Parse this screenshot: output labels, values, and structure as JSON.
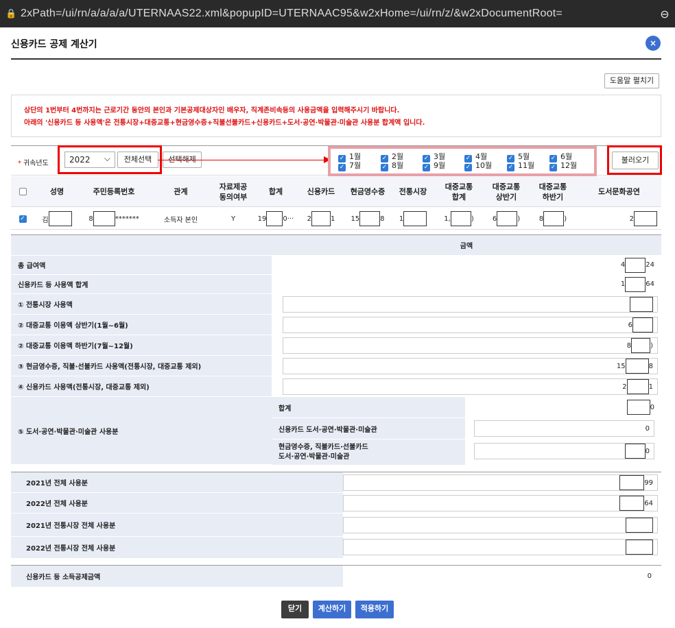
{
  "browser": {
    "url": "2xPath=/ui/rn/a/a/a/a/UTERNAAS22.xml&popupID=UTERNAAC95&w2xHome=/ui/rn/z/&w2xDocumentRoot=",
    "lock_icon": "lock-icon",
    "zoom_icon": "zoom-icon"
  },
  "popup": {
    "title": "신용카드 공제 계산기",
    "close_symbol": "×",
    "help_label": "도움말 펼치기"
  },
  "notice": {
    "line1": "상단의 1번부터 4번까지는 근로기간 동안의 본인과 기본공제대상자인 배우자, 직계존비속등의 사용금액을 입력해주시기 바랍니다.",
    "line2": "아래의 '신용카드 등 사용액'은 전통시장+대중교통+현금영수증+직불선불카드+신용카드+도서·공연·박물관·미술관 사용분 합계액 입니다.",
    "color": "#dd1111"
  },
  "controls": {
    "year_label": "귀속년도",
    "year_value": "2022",
    "select_all": "전체선택",
    "deselect_all": "선택해제",
    "load": "불러오기",
    "months": [
      "1월",
      "2월",
      "3월",
      "4월",
      "5월",
      "6월",
      "7월",
      "8월",
      "9월",
      "10월",
      "11월",
      "12월"
    ]
  },
  "grid": {
    "headers": [
      "성명",
      "주민등록번호",
      "관계",
      "자료제공\n동의여부",
      "합계",
      "신용카드",
      "현금영수증",
      "전통시장",
      "대중교통\n합계",
      "대중교통\n상반기",
      "대중교통\n하반기",
      "도서문화공연"
    ],
    "row": {
      "name": "김",
      "rrn_prefix": "8",
      "rrn_suffix": "*******",
      "relation": "소득자 본인",
      "consent": "Y",
      "total_a": "19",
      "total_b": "0···",
      "credit_a": "2",
      "credit_b": "1",
      "cash_a": "15",
      "cash_b": "8",
      "market": "1",
      "transit_total_a": "1,",
      "transit_total_b": ")",
      "transit_h1_a": "6",
      "transit_h1_b": ")",
      "transit_h2_a": "8",
      "transit_h2_b": ")",
      "culture": "2"
    }
  },
  "calc": {
    "amount_header": "금액",
    "rows": [
      {
        "label": "총 급여액",
        "pre": "4",
        "post": "24"
      },
      {
        "label": "신용카드 등 사용액 합계",
        "pre": "1",
        "post": "64"
      },
      {
        "label": "① 전통시장 사용액",
        "pre": "",
        "post": ""
      },
      {
        "label": "② 대중교통 이용액 상반기(1월~6월)",
        "pre": "6",
        "post": ""
      },
      {
        "label": "② 대중교통 이용액 하반기(7월~12월)",
        "pre": "8",
        "post": ")"
      },
      {
        "label": "③ 현금영수증, 직불·선불카드 사용액(전통시장, 대중교통 제외)",
        "pre": "15",
        "post": "8"
      },
      {
        "label": "④ 신용카드 사용액(전통시장, 대중교통 제외)",
        "pre": "2",
        "post": "1"
      }
    ],
    "culture": {
      "label": "⑤ 도서·공연·박물관·미술관 사용분",
      "sum_label": "합계",
      "sum_post": "0",
      "credit_label": "신용카드 도서·공연·박물관·미술관",
      "credit_value": "0",
      "cash_label_1": "현금영수증, 직불카드·선불카드",
      "cash_label_2": "도서·공연·박물관·미술관",
      "cash_post": "0"
    }
  },
  "yearly": [
    {
      "label": "2021년 전체 사용분",
      "post": "99"
    },
    {
      "label": "2022년 전체 사용분",
      "post": "64"
    },
    {
      "label": "2021년 전통시장 전체 사용분",
      "post": ""
    },
    {
      "label": "2022년 전통시장 전체 사용분",
      "post": ""
    }
  ],
  "deduction": {
    "label": "신용카드 등 소득공제금액",
    "value": "0"
  },
  "footer": {
    "close": "닫기",
    "calculate": "계산하기",
    "apply": "적용하기"
  }
}
